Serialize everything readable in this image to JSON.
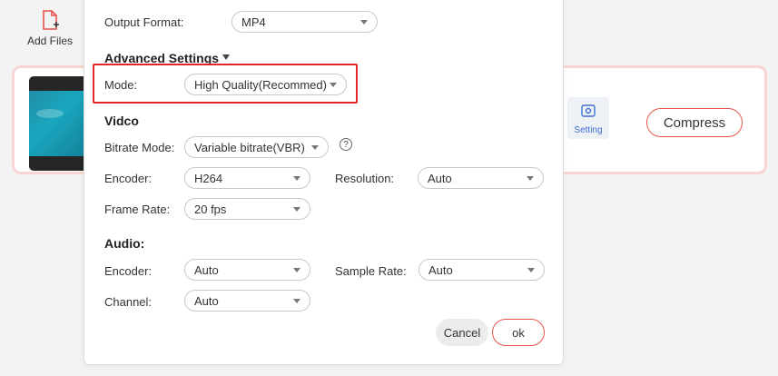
{
  "toolbar": {
    "add_files_label": "Add Files"
  },
  "file_item": {
    "setting_label": "Setting",
    "compress_label": "Compress"
  },
  "dialog": {
    "output_format": {
      "label": "Output Format:",
      "value": "MP4"
    },
    "advanced_settings_label": "Advanced Settings",
    "mode": {
      "label": "Mode:",
      "value": "High Quality(Recommed)"
    },
    "video": {
      "title": "Vidco",
      "bitrate_mode": {
        "label": "Bitrate Mode:",
        "value": "Variable bitrate(VBR)",
        "help": "?"
      },
      "encoder": {
        "label": "Encoder:",
        "value": "H264"
      },
      "resolution": {
        "label": "Resolution:",
        "value": "Auto"
      },
      "frame_rate": {
        "label": "Frame Rate:",
        "value": "20 fps"
      }
    },
    "audio": {
      "title": "Audio:",
      "encoder": {
        "label": "Encoder:",
        "value": "Auto"
      },
      "sample_rate": {
        "label": "Sample Rate:",
        "value": "Auto"
      },
      "channel": {
        "label": "Channel:",
        "value": "Auto"
      }
    },
    "cancel_label": "Cancel",
    "ok_label": "ok"
  },
  "colors": {
    "accent": "#e8524a",
    "highlight": "#e0262b",
    "setting_blue": "#3b6fd4"
  }
}
